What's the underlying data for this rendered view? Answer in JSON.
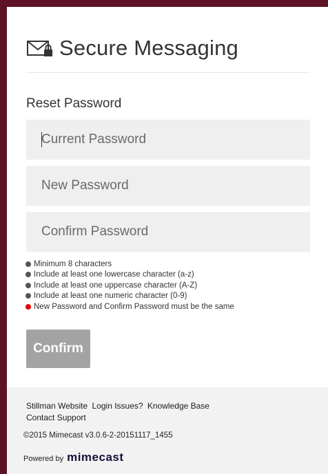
{
  "header": {
    "title": "Secure Messaging",
    "icon": "envelope-lock-icon"
  },
  "form": {
    "section_title": "Reset Password",
    "current_password_placeholder": "Current Password",
    "new_password_placeholder": "New Password",
    "confirm_password_placeholder": "Confirm Password",
    "confirm_label": "Confirm"
  },
  "rules": [
    {
      "text": "Minimum 8 characters",
      "status_color": "#555555"
    },
    {
      "text": "Include at least one lowercase character (a-z)",
      "status_color": "#555555"
    },
    {
      "text": "Include at least one uppercase character (A-Z)",
      "status_color": "#555555"
    },
    {
      "text": "Include at least one numeric character (0-9)",
      "status_color": "#555555"
    },
    {
      "text": "New Password and Confirm Password must be the same",
      "status_color": "#e00000"
    }
  ],
  "footer": {
    "links": [
      "Stillman Website",
      "Login Issues?",
      "Knowledge Base",
      "Contact Support"
    ],
    "copyright": "©2015 Mimecast v3.0.6-2-20151117_1455",
    "powered_by": "Powered by",
    "brand": "mimecast"
  },
  "colors": {
    "frame": "#5e1226",
    "field_bg": "#efefef",
    "button_bg": "#a3a3a3",
    "footer_bg": "#f2f2f2"
  }
}
